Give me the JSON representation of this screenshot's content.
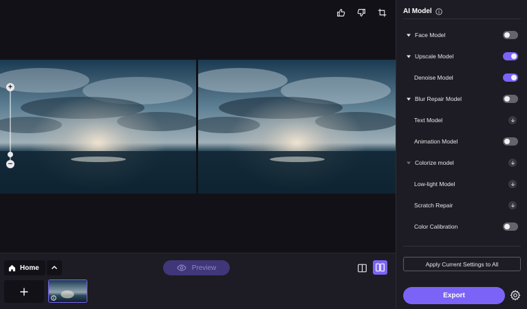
{
  "canvas": {
    "actions": [
      "thumbs-up-icon",
      "thumbs-down-icon",
      "crop-icon"
    ],
    "zoom_plus": "+",
    "zoom_minus": "−"
  },
  "bottom_bar": {
    "home_label": "Home",
    "preview_label": "Preview"
  },
  "panel": {
    "title": "AI Model",
    "models": [
      {
        "label": "Face Model",
        "caret": "expanded",
        "control": "toggle",
        "on": false
      },
      {
        "label": "Upscale Model",
        "caret": "expanded",
        "control": "toggle",
        "on": true
      },
      {
        "label": "Denoise Model",
        "caret": "none",
        "control": "toggle",
        "on": true
      },
      {
        "label": "Blur Repair Model",
        "caret": "expanded",
        "control": "toggle",
        "on": false
      },
      {
        "label": "Text Model",
        "caret": "none",
        "control": "download"
      },
      {
        "label": "Animation Model",
        "caret": "none",
        "control": "toggle",
        "on": false
      },
      {
        "label": "Colorize model",
        "caret": "collapsed-dim",
        "control": "download"
      },
      {
        "label": "Low-light Model",
        "caret": "none",
        "control": "download"
      },
      {
        "label": "Scratch Repair",
        "caret": "none",
        "control": "download"
      },
      {
        "label": "Color Calibration",
        "caret": "none",
        "control": "toggle",
        "on": false
      }
    ],
    "apply_label": "Apply Current Settings to All",
    "export_label": "Export"
  },
  "colors": {
    "accent": "#7c63f7",
    "background": "#121117",
    "panel": "#1d1c24"
  }
}
